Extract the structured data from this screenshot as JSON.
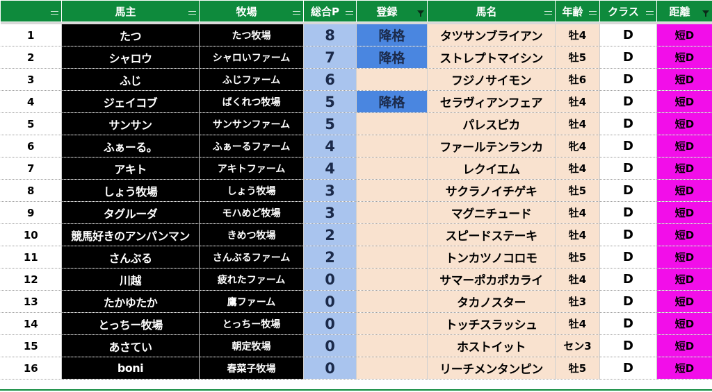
{
  "header": {
    "rownum": "",
    "owner": "馬主",
    "farm": "牧場",
    "points": "総合P",
    "registration": "登録",
    "horse": "馬名",
    "age": "年齢",
    "class": "クラス",
    "distance": "距離"
  },
  "colors": {
    "header_bg": "#0e8a3c",
    "points_bg": "#a9c4ee",
    "demotion_bg": "#4a86e0",
    "peach_bg": "#f9e2cf",
    "distance_bg": "#f20ee9",
    "owner_bg": "#000000"
  },
  "rows": [
    {
      "no": "1",
      "owner": "たつ",
      "farm": "たつ牧場",
      "points": "8",
      "registration": "降格",
      "horse": "タツサンブライアン",
      "age": "牡4",
      "class": "D",
      "distance": "短D"
    },
    {
      "no": "2",
      "owner": "シャロウ",
      "farm": "シャロいファーム",
      "points": "7",
      "registration": "降格",
      "horse": "ストレプトマイシン",
      "age": "牡5",
      "class": "D",
      "distance": "短D"
    },
    {
      "no": "3",
      "owner": "ふじ",
      "farm": "ふじファーム",
      "points": "6",
      "registration": "",
      "horse": "フジノサイモン",
      "age": "牡6",
      "class": "D",
      "distance": "短D"
    },
    {
      "no": "4",
      "owner": "ジェイコブ",
      "farm": "ばくれつ牧場",
      "points": "5",
      "registration": "降格",
      "horse": "セラヴィアンフェア",
      "age": "牡4",
      "class": "D",
      "distance": "短D"
    },
    {
      "no": "5",
      "owner": "サンサン",
      "farm": "サンサンファーム",
      "points": "5",
      "registration": "",
      "horse": "パレスピカ",
      "age": "牡4",
      "class": "D",
      "distance": "短D"
    },
    {
      "no": "6",
      "owner": "ふぁーる。",
      "farm": "ふぁーるファーム",
      "points": "4",
      "registration": "",
      "horse": "ファールテンランカ",
      "age": "牝4",
      "class": "D",
      "distance": "短D"
    },
    {
      "no": "7",
      "owner": "アキト",
      "farm": "アキトファーム",
      "points": "4",
      "registration": "",
      "horse": "レクイエム",
      "age": "牡4",
      "class": "D",
      "distance": "短D"
    },
    {
      "no": "8",
      "owner": "しょう牧場",
      "farm": "しょう牧場",
      "points": "3",
      "registration": "",
      "horse": "サクラノイチゲキ",
      "age": "牡5",
      "class": "D",
      "distance": "短D"
    },
    {
      "no": "9",
      "owner": "タグルーダ",
      "farm": "モハめど牧場",
      "points": "3",
      "registration": "",
      "horse": "マグニチュード",
      "age": "牡4",
      "class": "D",
      "distance": "短D"
    },
    {
      "no": "10",
      "owner": "競馬好きのアンパンマン",
      "farm": "きめつ牧場",
      "points": "2",
      "registration": "",
      "horse": "スピードステーキ",
      "age": "牡4",
      "class": "D",
      "distance": "短D"
    },
    {
      "no": "11",
      "owner": "さんぶる",
      "farm": "さんぶるファーム",
      "points": "2",
      "registration": "",
      "horse": "トンカツノコロモ",
      "age": "牡5",
      "class": "D",
      "distance": "短D"
    },
    {
      "no": "12",
      "owner": "川越",
      "farm": "疲れたファーム",
      "points": "0",
      "registration": "",
      "horse": "サマーポカポカライ",
      "age": "牡4",
      "class": "D",
      "distance": "短D"
    },
    {
      "no": "13",
      "owner": "たかゆたか",
      "farm": "鷹ファーム",
      "points": "0",
      "registration": "",
      "horse": "タカノスター",
      "age": "牡3",
      "class": "D",
      "distance": "短D"
    },
    {
      "no": "14",
      "owner": "とっちー牧場",
      "farm": "とっちー牧場",
      "points": "0",
      "registration": "",
      "horse": "トッチスラッシュ",
      "age": "牡4",
      "class": "D",
      "distance": "短D"
    },
    {
      "no": "15",
      "owner": "あさてい",
      "farm": "朝定牧場",
      "points": "0",
      "registration": "",
      "horse": "ホストイット",
      "age": "セン3",
      "class": "D",
      "distance": "短D"
    },
    {
      "no": "16",
      "owner": "boni",
      "farm": "春菜子牧場",
      "points": "0",
      "registration": "",
      "horse": "リーチメンタンピン",
      "age": "牡5",
      "class": "D",
      "distance": "短D"
    }
  ]
}
